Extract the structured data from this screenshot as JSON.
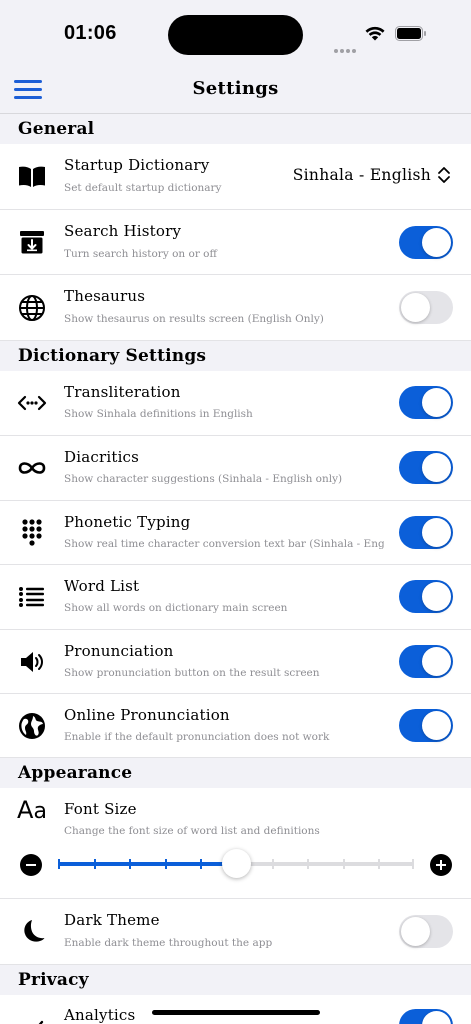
{
  "status_bar": {
    "time": "01:06"
  },
  "nav": {
    "title": "Settings"
  },
  "sections": {
    "general": "General",
    "dictionary": "Dictionary Settings",
    "appearance": "Appearance",
    "privacy": "Privacy"
  },
  "general": {
    "startup": {
      "title": "Startup Dictionary",
      "subtitle": "Set default startup dictionary",
      "value": "Sinhala - English",
      "icon": "book-icon"
    },
    "search_history": {
      "title": "Search History",
      "subtitle": "Turn search history on or off",
      "enabled": true,
      "icon": "archive-icon"
    },
    "thesaurus": {
      "title": "Thesaurus",
      "subtitle": "Show thesaurus on results screen (English Only)",
      "enabled": false,
      "icon": "globe-icon"
    }
  },
  "dictionary": {
    "transliteration": {
      "title": "Transliteration",
      "subtitle": "Show Sinhala definitions in English",
      "enabled": true,
      "icon": "code-arrows-icon"
    },
    "diacritics": {
      "title": "Diacritics",
      "subtitle": "Show character suggestions (Sinhala - English only)",
      "enabled": true,
      "icon": "infinity-icon"
    },
    "phonetic": {
      "title": "Phonetic Typing",
      "subtitle": "Show real time character conversion text bar (Sinhala - English on",
      "enabled": true,
      "icon": "keypad-icon"
    },
    "word_list": {
      "title": "Word List",
      "subtitle": "Show all words on dictionary main screen",
      "enabled": true,
      "icon": "list-icon"
    },
    "pronunciation": {
      "title": "Pronunciation",
      "subtitle": "Show pronunciation button on the result screen",
      "enabled": true,
      "icon": "speaker-icon"
    },
    "online_pronunciation": {
      "title": "Online Pronunciation",
      "subtitle": "Enable if the default pronunciation does not work",
      "enabled": true,
      "icon": "earth-icon"
    }
  },
  "appearance": {
    "font_size": {
      "title": "Font Size",
      "subtitle": "Change the font size of word list and definitions",
      "icon": "text-size-icon",
      "slider_steps": 10,
      "slider_value": 5
    },
    "dark_theme": {
      "title": "Dark Theme",
      "subtitle": "Enable dark theme throughout the app",
      "enabled": false,
      "icon": "moon-icon"
    }
  },
  "privacy": {
    "analytics": {
      "title": "Analytics",
      "enabled": true,
      "icon": "chart-icon"
    }
  },
  "colors": {
    "accent": "#0b5fd9",
    "toggle_off": "#e4e4e8",
    "background": "#f2f2f7"
  }
}
